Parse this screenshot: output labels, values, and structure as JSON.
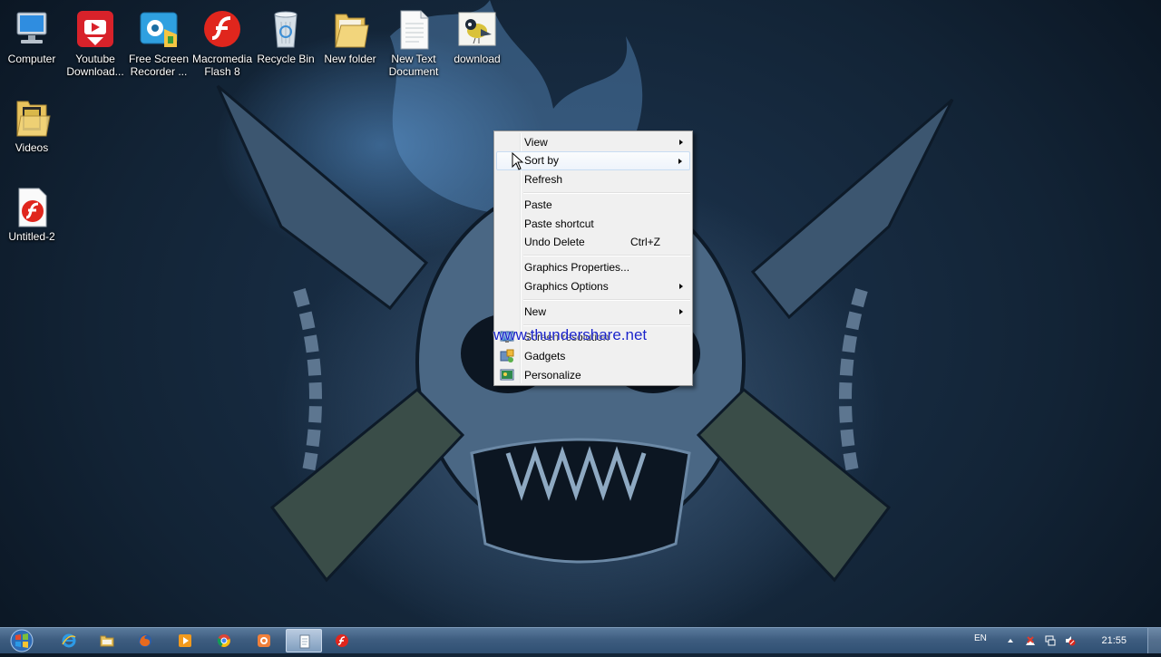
{
  "desktop": {
    "icons": [
      {
        "label": "Computer",
        "icon": "computer-icon"
      },
      {
        "label": "Youtube Download...",
        "icon": "youtube-downloader-icon"
      },
      {
        "label": "Free Screen Recorder ...",
        "icon": "screen-recorder-icon"
      },
      {
        "label": "Macromedia Flash 8",
        "icon": "flash-icon"
      },
      {
        "label": "Recycle Bin",
        "icon": "recycle-bin-icon"
      },
      {
        "label": "New folder",
        "icon": "folder-icon"
      },
      {
        "label": "New Text Document",
        "icon": "text-document-icon"
      },
      {
        "label": "download",
        "icon": "bird-image-icon"
      },
      {
        "label": "Videos",
        "icon": "folder-icon"
      },
      {
        "label": "Untitled-2",
        "icon": "flash-document-icon"
      }
    ]
  },
  "context_menu": {
    "items": [
      {
        "label": "View",
        "submenu": true
      },
      {
        "label": "Sort by",
        "submenu": true,
        "hovered": true
      },
      {
        "label": "Refresh"
      },
      {
        "label": "Paste"
      },
      {
        "label": "Paste shortcut"
      },
      {
        "label": "Undo Delete",
        "shortcut": "Ctrl+Z"
      },
      {
        "label": "Graphics Properties..."
      },
      {
        "label": "Graphics Options",
        "submenu": true
      },
      {
        "label": "New",
        "submenu": true
      },
      {
        "label": "Screen resolution",
        "icon": "screen-resolution-icon"
      },
      {
        "label": "Gadgets",
        "icon": "gadgets-icon"
      },
      {
        "label": "Personalize",
        "icon": "personalize-icon"
      }
    ]
  },
  "watermark": "www.thundershare.net",
  "taskbar": {
    "start": "windows-logo-icon",
    "pinned": [
      "internet-explorer-icon",
      "file-explorer-icon",
      "firefox-icon",
      "media-player-icon",
      "chrome-icon",
      "app-icon",
      "notepad-icon",
      "flash-player-icon"
    ],
    "tray": {
      "language": "EN",
      "time": "21:55"
    }
  },
  "colors": {
    "menu_bg": "#f0f0f0",
    "menu_hover": "#eef4fb",
    "watermark": "#1a23c8",
    "taskbar": "#3e5d80"
  }
}
